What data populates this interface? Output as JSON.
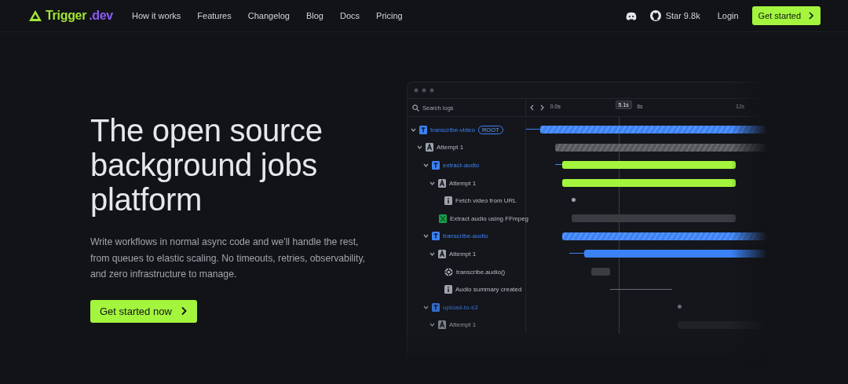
{
  "nav": {
    "logo": {
      "name": "Trigger",
      "suffix": ".dev"
    },
    "links": [
      "How it works",
      "Features",
      "Changelog",
      "Blog",
      "Docs",
      "Pricing"
    ],
    "github": {
      "label": "Star 9.8k"
    },
    "login": "Login",
    "cta": "Get started"
  },
  "hero": {
    "title": "The open source background jobs platform",
    "text": "Write workflows in normal async code and we'll handle the rest, from queues to elastic scaling. No timeouts, retries, observability, and zero infrastructure to manage.",
    "button": "Get started now"
  },
  "run_view": {
    "search": {
      "placeholder": "Search logs"
    },
    "time_labels": [
      "0.0s",
      "5.1s",
      "6s",
      "12s"
    ],
    "tree": [
      {
        "label": "transcribe-video",
        "kind": "task",
        "badge": "ROOT",
        "expanded": true,
        "children": [
          {
            "label": "Attempt 1",
            "kind": "attempt",
            "expanded": true,
            "children": [
              {
                "label": "extract-audio",
                "kind": "task",
                "expanded": true,
                "children": [
                  {
                    "label": "Attempt 1",
                    "kind": "attempt",
                    "expanded": true,
                    "children": [
                      {
                        "label": "Fetch video from URL",
                        "kind": "log"
                      },
                      {
                        "label": "Extract audio using FFmpeg",
                        "kind": "span"
                      }
                    ]
                  }
                ]
              },
              {
                "label": "transcribe-audio",
                "kind": "task",
                "expanded": true,
                "children": [
                  {
                    "label": "Attempt 1",
                    "kind": "attempt",
                    "expanded": true,
                    "children": [
                      {
                        "label": "transcribe.audio()",
                        "kind": "api"
                      },
                      {
                        "label": "Audio summary created",
                        "kind": "log"
                      }
                    ]
                  }
                ]
              },
              {
                "label": "upload-to-s3",
                "kind": "task",
                "expanded": true,
                "children": [
                  {
                    "label": "Attempt 1",
                    "kind": "attempt",
                    "expanded": true
                  }
                ]
              }
            ]
          }
        ]
      }
    ]
  }
}
